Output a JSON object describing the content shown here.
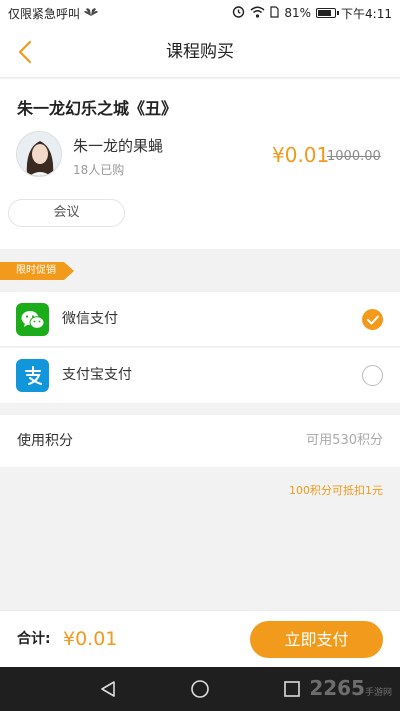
{
  "status_bar": {
    "carrier_text": "仅限紧急呼叫",
    "battery": "81%",
    "battery_level": 0.81,
    "time": "下午4:11"
  },
  "nav": {
    "title": "课程购买"
  },
  "course": {
    "title": "朱一龙幻乐之城《丑》",
    "teacher": "朱一龙的果蝇",
    "buyers": "18人已购",
    "price_now": "¥0.01",
    "price_old": "1000.00",
    "tag": "会议"
  },
  "promo": {
    "label": "限时促销"
  },
  "payment": {
    "options": [
      {
        "label": "微信支付",
        "selected": true
      },
      {
        "label": "支付宝支付",
        "selected": false
      }
    ]
  },
  "points": {
    "label": "使用积分",
    "available": "可用530积分",
    "note": "100积分可抵扣1元"
  },
  "footer": {
    "total_label": "合计:",
    "total_amount": "¥0.01",
    "pay_button": "立即支付"
  },
  "watermark": {
    "text": "2265",
    "sub": "手游网"
  },
  "colors": {
    "accent": "#f29a1b",
    "wechat": "#1aad19",
    "alipay": "#1296db"
  }
}
